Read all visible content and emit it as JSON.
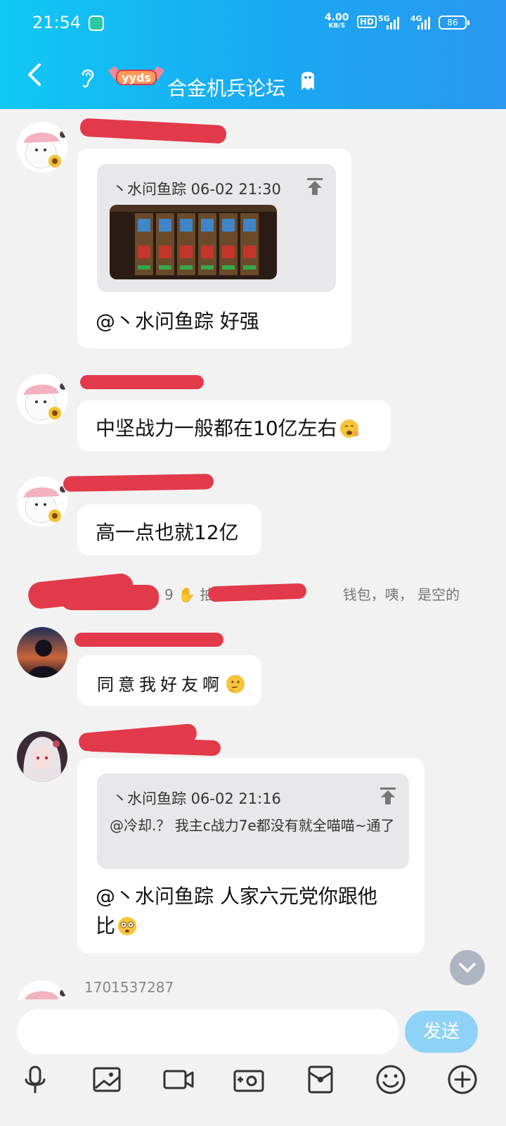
{
  "status_bar": {
    "time": "21:54",
    "net_speed_value": "4.00",
    "net_speed_unit": "KB/S",
    "hd_badge": "HD",
    "sig1": "5G",
    "sig2": "4G",
    "battery": "86"
  },
  "header": {
    "badge_text": "yyds",
    "title": "合金机兵论坛"
  },
  "messages": [
    {
      "quote": {
        "author_time": "丶水问鱼踪 06-02 21:30",
        "has_image": true
      },
      "text": "@丶水问鱼踪 好强"
    },
    {
      "text": "中坚战力一般都在10亿左右"
    },
    {
      "text": "高一点也就12亿"
    },
    {
      "text": "同意我好友啊"
    },
    {
      "quote": {
        "author_time": "丶水问鱼踪 06-02 21:16",
        "body": "@冷却.？ 我主c战力7e都没有就全喵喵~通了"
      },
      "text_line1": "@丶水问鱼踪 人家六元党你跟他",
      "text_line2": "比"
    }
  ],
  "system_message": {
    "part1": "9",
    "part2": "拍了拍1",
    "part3": "钱包，咦， 是空的"
  },
  "next_sender": "1701537287",
  "composer": {
    "send_label": "发送"
  },
  "toolbar_icons": [
    "microphone-icon",
    "image-icon",
    "video-icon",
    "camera-icon",
    "red-packet-icon",
    "emoji-icon",
    "plus-icon"
  ]
}
